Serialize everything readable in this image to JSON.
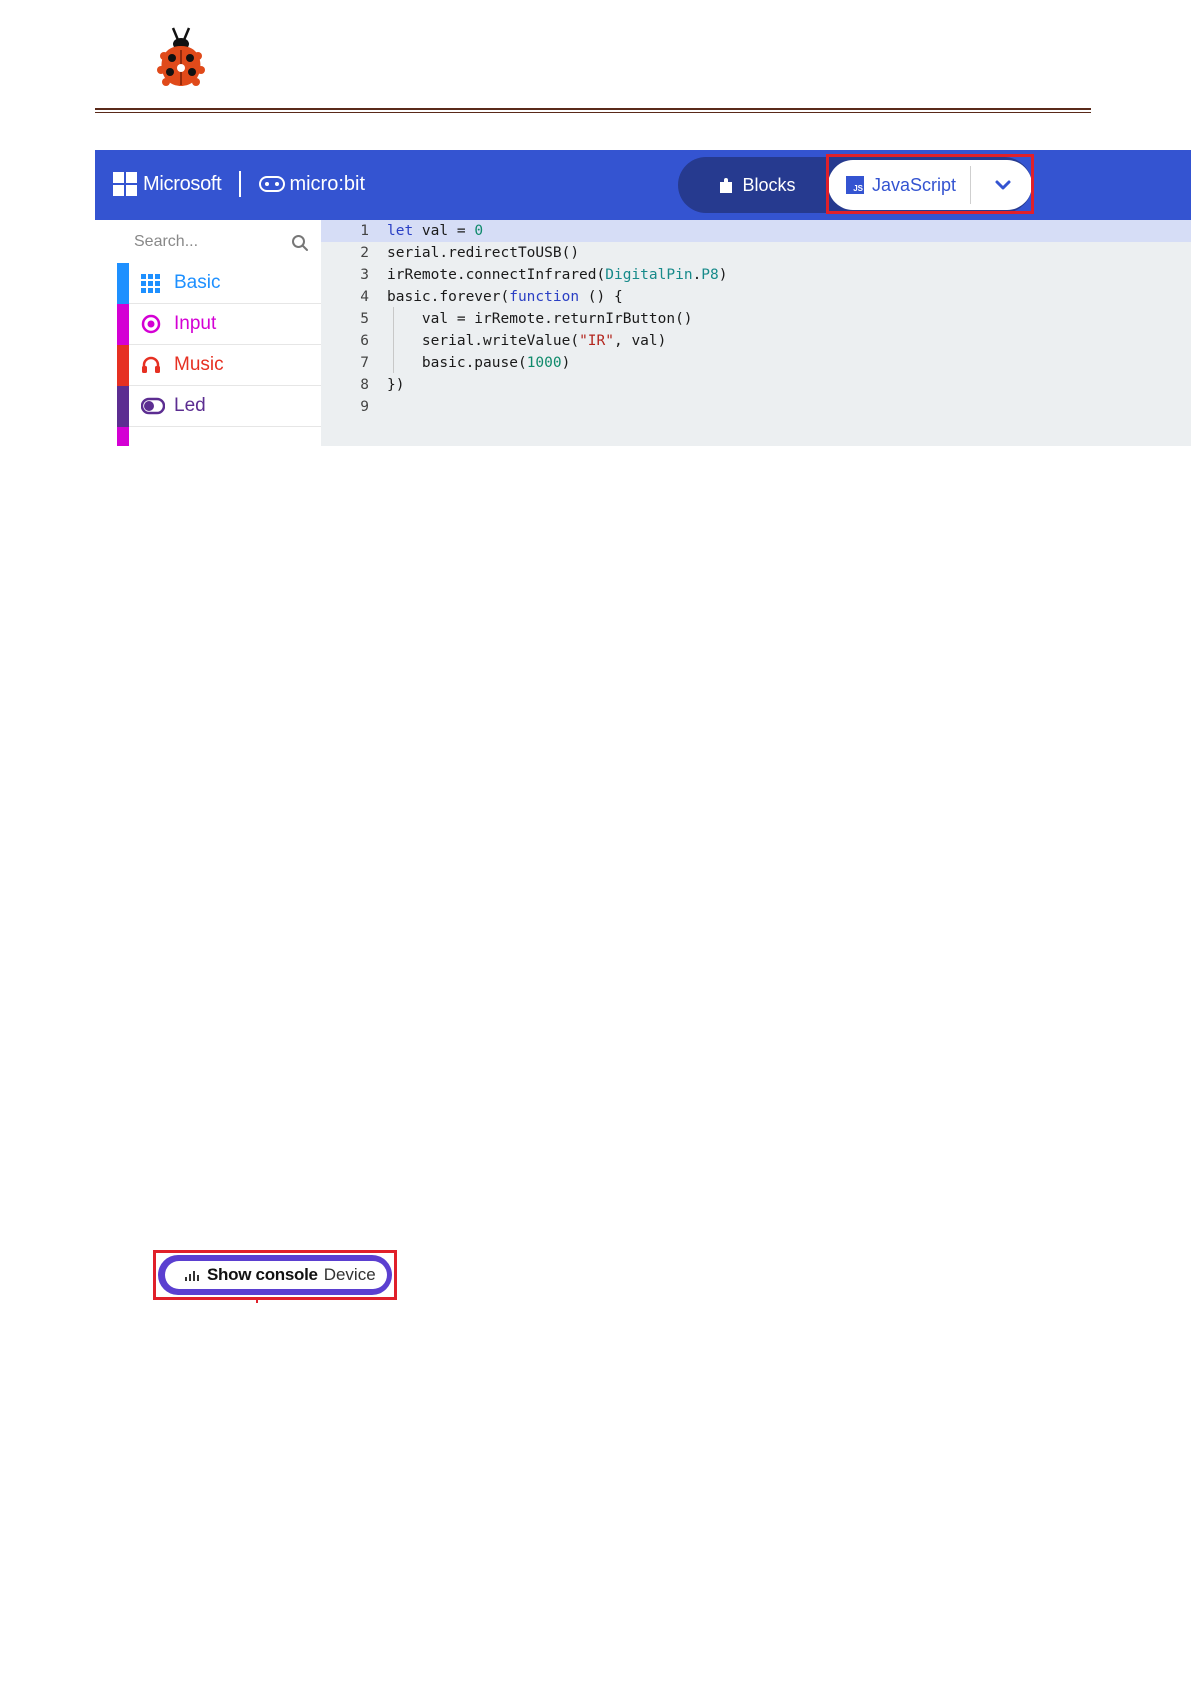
{
  "header": {
    "logo_icon": "ladybug-icon",
    "rule_color": "#5a2a1a"
  },
  "screenshot": {
    "topbar": {
      "brand_microsoft": "Microsoft",
      "brand_microbit": "micro:bit",
      "blocks_label": "Blocks",
      "javascript_label": "JavaScript",
      "js_icon_text": "JS",
      "background": "#3454d1",
      "highlight_color": "#e0202a"
    },
    "toolbox": {
      "search_placeholder": "Search...",
      "categories": [
        {
          "label": "Basic",
          "color": "#1e90ff",
          "icon": "grid-icon"
        },
        {
          "label": "Input",
          "color": "#d400d4",
          "icon": "target-icon"
        },
        {
          "label": "Music",
          "color": "#e63022",
          "icon": "headphones-icon"
        },
        {
          "label": "Led",
          "color": "#5c2d91",
          "icon": "toggle-icon"
        }
      ]
    },
    "editor": {
      "line_numbers": [
        "1",
        "2",
        "3",
        "4",
        "5",
        "6",
        "7",
        "8",
        "9"
      ],
      "lines": [
        "let val = 0",
        "serial.redirectToUSB()",
        "irRemote.connectInfrared(DigitalPin.P8)",
        "basic.forever(function () {",
        "    val = irRemote.returnIrButton()",
        "    serial.writeValue(\"IR\", val)",
        "    basic.pause(1000)",
        "})",
        ""
      ]
    }
  },
  "console_button": {
    "show_console_label": "Show console",
    "device_label": "Device"
  }
}
